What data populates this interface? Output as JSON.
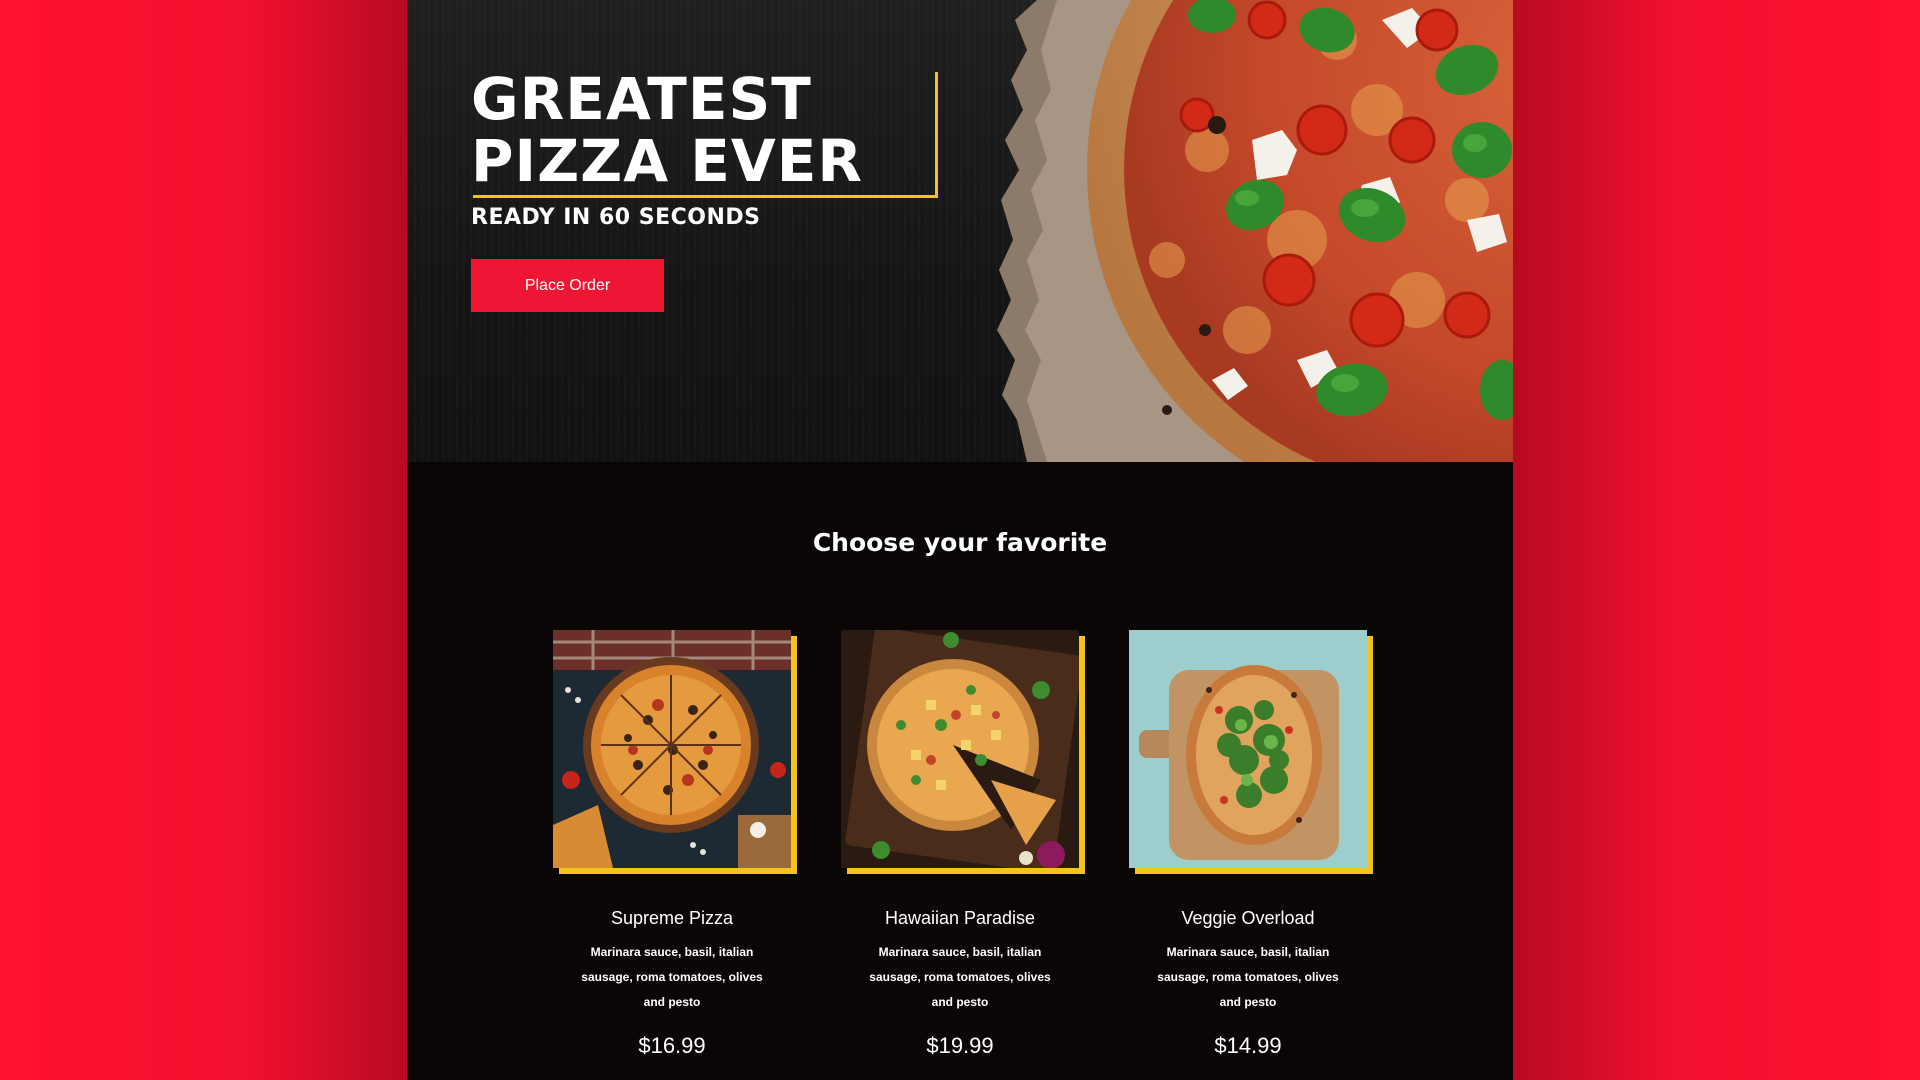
{
  "hero": {
    "title_line1": "GREATEST",
    "title_line2": "PIZZA EVER",
    "subtitle": "READY IN 60 SECONDS",
    "cta_label": "Place Order"
  },
  "menu": {
    "heading": "Choose your favorite",
    "items": [
      {
        "name": "Supreme Pizza",
        "description": "Marinara sauce, basil, italian sausage, roma tomatoes, olives and pesto",
        "price": "$16.99"
      },
      {
        "name": "Hawaiian Paradise",
        "description": "Marinara sauce, basil, italian sausage, roma tomatoes, olives and pesto",
        "price": "$19.99"
      },
      {
        "name": "Veggie Overload",
        "description": "Marinara sauce, basil, italian sausage, roma tomatoes, olives and pesto",
        "price": "$14.99"
      }
    ]
  },
  "colors": {
    "brand_red": "#ef1534",
    "accent_yellow": "#f3c41b",
    "page_dark": "#0b0606"
  }
}
